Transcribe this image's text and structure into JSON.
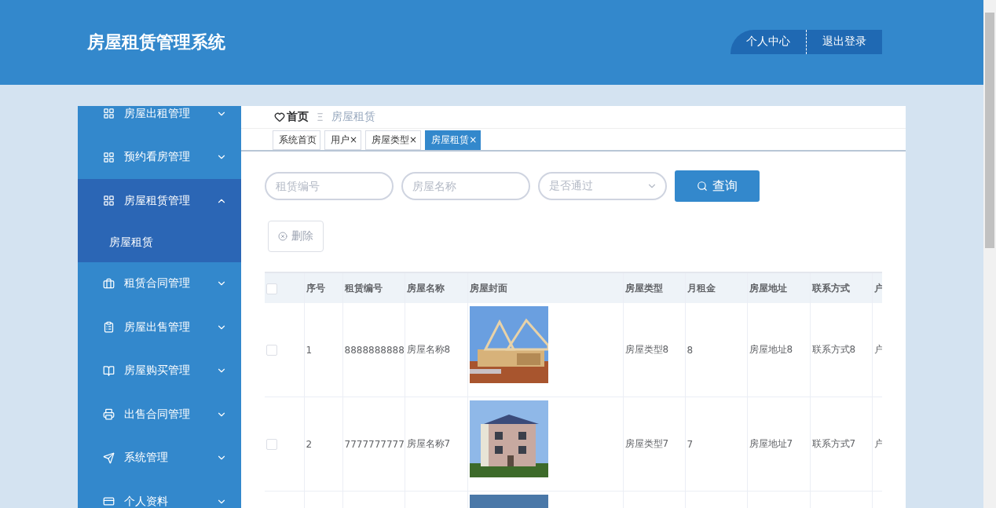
{
  "header": {
    "title": "房屋租赁管理系统",
    "actions": [
      {
        "label": "个人中心"
      },
      {
        "label": "退出登录"
      }
    ]
  },
  "sidebar": {
    "items": [
      {
        "label": "房屋出租管理",
        "expanded": false
      },
      {
        "label": "预约看房管理",
        "expanded": false
      },
      {
        "label": "房屋租赁管理",
        "expanded": true,
        "children": [
          {
            "label": "房屋租赁"
          }
        ]
      },
      {
        "label": "租赁合同管理",
        "expanded": false
      },
      {
        "label": "房屋出售管理",
        "expanded": false
      },
      {
        "label": "房屋购买管理",
        "expanded": false
      },
      {
        "label": "出售合同管理",
        "expanded": false
      },
      {
        "label": "系统管理",
        "expanded": false
      },
      {
        "label": "个人资料",
        "expanded": false
      }
    ]
  },
  "breadcrumb": {
    "home": "首页",
    "separator": "Ξ",
    "current": "房屋租赁"
  },
  "tabs": [
    {
      "label": "系统首页",
      "selected": false
    },
    {
      "label": "用户",
      "close": "×",
      "selected": false
    },
    {
      "label": "房屋类型",
      "close": "×",
      "selected": false
    },
    {
      "label": "房屋租赁",
      "close": "×",
      "selected": true
    }
  ],
  "search": {
    "fields": [
      {
        "kind": "input",
        "placeholder": "租赁编号"
      },
      {
        "kind": "input",
        "placeholder": "房屋名称"
      },
      {
        "kind": "select",
        "placeholder": "是否通过"
      }
    ],
    "button": "查询"
  },
  "delete_button": {
    "label": "删除",
    "disabled": true
  },
  "table": {
    "header_checked": false,
    "columns": [
      "序号",
      "租赁编号",
      "房屋名称",
      "房屋封面",
      "房屋类型",
      "月租金",
      "房屋地址",
      "联系方式",
      "户"
    ],
    "rows": [
      {
        "checked": false,
        "cells": [
          "1",
          "8888888888",
          "房屋名称8",
          {
            "kind": "picture"
          },
          "房屋类型8",
          "8",
          "房屋地址8",
          "联系方式8",
          "户"
        ]
      },
      {
        "checked": false,
        "cells": [
          "2",
          "7777777777",
          "房屋名称7",
          {
            "kind": "picture"
          },
          "房屋类型7",
          "7",
          "房屋地址7",
          "联系方式7",
          "户"
        ]
      },
      {
        "cells": [
          null,
          null,
          null,
          {
            "kind": "picture"
          }
        ]
      }
    ]
  }
}
